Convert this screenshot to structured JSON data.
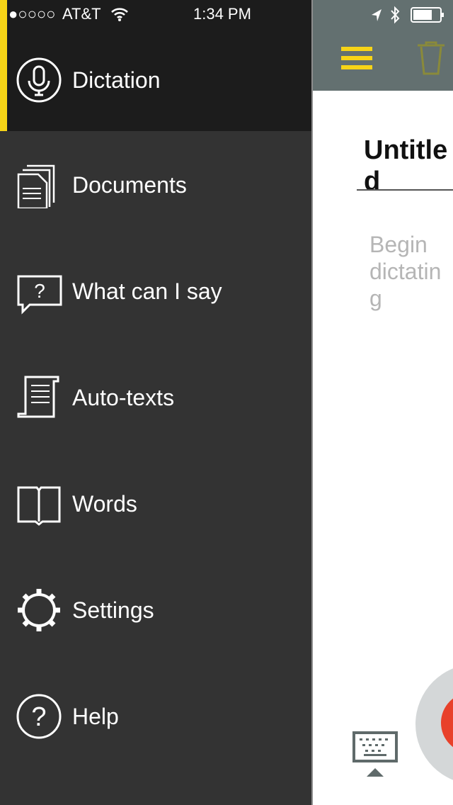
{
  "status_bar": {
    "signal": "●○○○○",
    "carrier": "AT&T",
    "time": "1:34 PM",
    "icons": [
      "wifi-icon",
      "location-icon",
      "bluetooth-icon",
      "battery-icon"
    ]
  },
  "menu": {
    "items": [
      {
        "label": "Dictation",
        "icon": "microphone-icon",
        "active": true
      },
      {
        "label": "Documents",
        "icon": "documents-icon"
      },
      {
        "label": "What can I say",
        "icon": "speech-bubble-question-icon"
      },
      {
        "label": "Auto-texts",
        "icon": "scroll-icon"
      },
      {
        "label": "Words",
        "icon": "book-icon"
      },
      {
        "label": "Settings",
        "icon": "gear-icon"
      },
      {
        "label": "Help",
        "icon": "help-icon"
      }
    ]
  },
  "document": {
    "title": "Untitled",
    "placeholder": "Begin dictating"
  },
  "colors": {
    "accent": "#f7d417",
    "menu_bg": "#333333",
    "active_bg": "#1c1c1c",
    "toolbar": "#637070",
    "record": "#e8412a"
  }
}
